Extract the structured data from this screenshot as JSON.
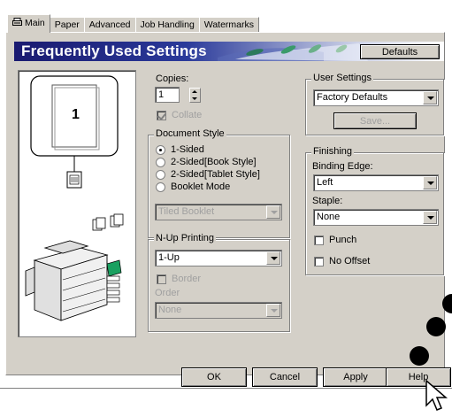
{
  "tabs": [
    {
      "label": "Main",
      "active": true
    },
    {
      "label": "Paper",
      "active": false
    },
    {
      "label": "Advanced",
      "active": false
    },
    {
      "label": "Job Handling",
      "active": false
    },
    {
      "label": "Watermarks",
      "active": false
    }
  ],
  "banner": {
    "title": "Frequently Used Settings",
    "defaults_label": "Defaults"
  },
  "preview": {
    "page_number": "1"
  },
  "copies": {
    "label": "Copies:",
    "value": "1"
  },
  "collate": {
    "label": "Collate",
    "checked": true,
    "enabled": false
  },
  "document_style": {
    "label": "Document Style",
    "options": [
      "1-Sided",
      "2-Sided[Book Style]",
      "2-Sided[Tablet Style]",
      "Booklet Mode"
    ],
    "selected": "1-Sided",
    "booklet_value": "Tiled Booklet"
  },
  "nup": {
    "label": "N-Up Printing",
    "value": "1-Up",
    "border_label": "Border",
    "order_label": "Order",
    "order_value": "None"
  },
  "user_settings": {
    "label": "User Settings",
    "value": "Factory Defaults",
    "save_label": "Save..."
  },
  "finishing": {
    "label": "Finishing",
    "binding_label": "Binding Edge:",
    "binding_value": "Left",
    "staple_label": "Staple:",
    "staple_value": "None",
    "punch_label": "Punch",
    "no_offset_label": "No Offset"
  },
  "footer": {
    "ok": "OK",
    "cancel": "Cancel",
    "apply": "Apply",
    "help": "Help"
  },
  "colors": {
    "banner_dark": "#1a1a70",
    "dialog_face": "#d4d0c8",
    "disabled_text": "#a0a0a0"
  }
}
